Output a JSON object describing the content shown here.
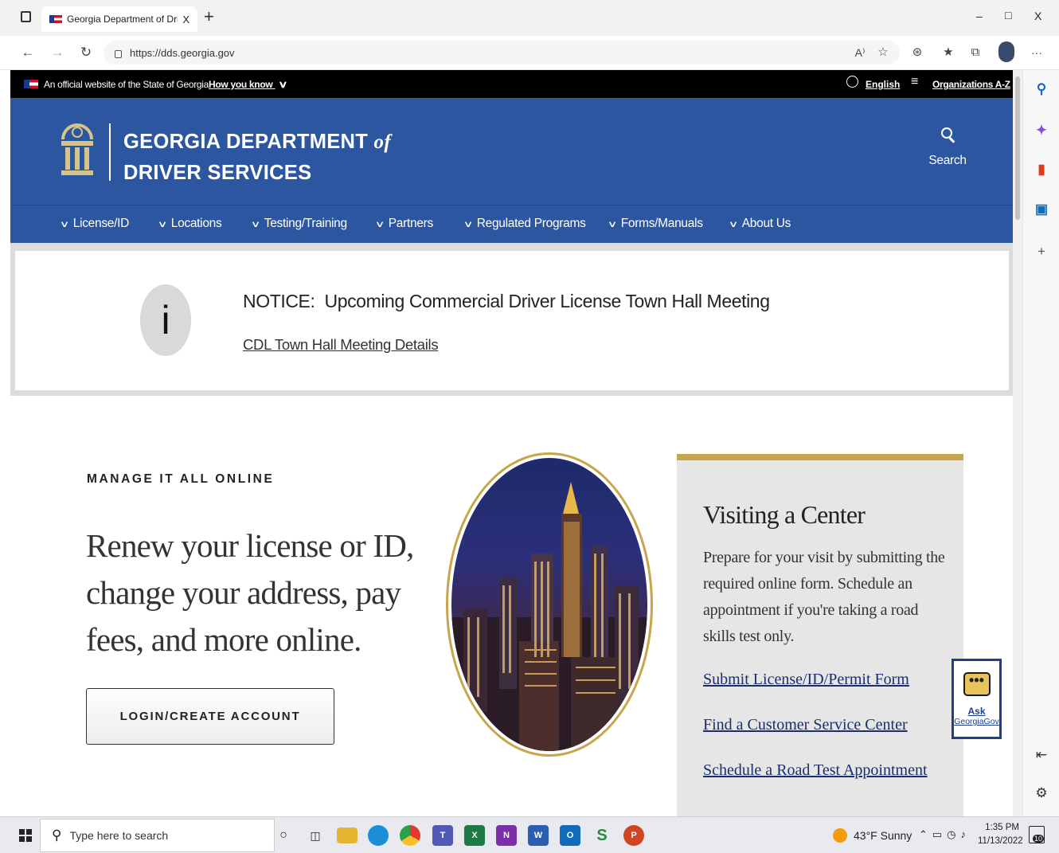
{
  "browser": {
    "tab_title": "Georgia Department of Driver Se",
    "tab_close": "X",
    "new_tab": "+",
    "url": "https://dds.georgia.gov",
    "window_controls": {
      "minimize": "–",
      "restore": "□",
      "close": "X"
    },
    "toolbar_icons": [
      "read-aloud-icon",
      "favorite-icon",
      "extensions-icon",
      "favorites-icon",
      "collections-icon",
      "profile-icon",
      "more-icon"
    ],
    "more_label": "···"
  },
  "gov_banner": {
    "text": "An official website of the State of Georgia.",
    "how_link": "How you know",
    "language": "English",
    "organizations": "Organizations A-Z"
  },
  "header": {
    "title_line1": "GEORGIA DEPARTMENT",
    "title_of": "of",
    "title_line2": "DRIVER SERVICES",
    "search_label": "Search"
  },
  "nav": {
    "items": [
      {
        "label": "License/ID"
      },
      {
        "label": "Locations"
      },
      {
        "label": "Testing/Training"
      },
      {
        "label": "Partners"
      },
      {
        "label": "Regulated Programs"
      },
      {
        "label": "Forms/Manuals"
      },
      {
        "label": "About Us"
      }
    ]
  },
  "notice": {
    "icon_letter": "i",
    "heading_prefix": "NOTICE:",
    "heading": "Upcoming Commercial Driver License Town Hall Meeting",
    "link": "CDL Town Hall Meeting Details"
  },
  "manage": {
    "eyebrow": "MANAGE IT ALL ONLINE",
    "line1": "Renew your license or ID,",
    "line2": "change your address, pay",
    "line3": "fees, and more online.",
    "button": "LOGIN/CREATE ACCOUNT"
  },
  "visit": {
    "title": "Visiting a Center",
    "body1": "Prepare for your visit by submitting the",
    "body2": "required online form. Schedule an",
    "body3": "appointment if you're taking a road",
    "body4": "skills test only.",
    "links": [
      "Submit License/ID/Permit Form",
      "Find a Customer Service Center",
      "Schedule a Road Test Appointment"
    ]
  },
  "ask": {
    "line1": "Ask",
    "line2": "GeorgiaGov"
  },
  "taskbar": {
    "search_placeholder": "Type here to search",
    "weather": "43°F  Sunny",
    "time": "1:35 PM",
    "date": "11/13/2022",
    "notifications": "10"
  },
  "colors": {
    "brand_blue": "#2d56a0",
    "gold": "#c8a54a",
    "link_navy": "#1a2e6e"
  }
}
